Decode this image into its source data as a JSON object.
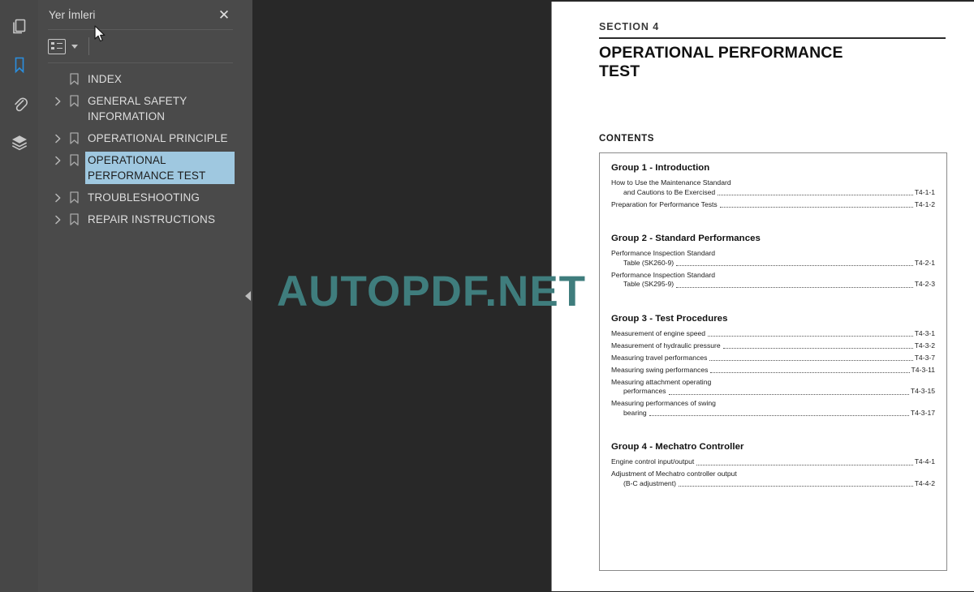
{
  "rail": {
    "items": [
      {
        "name": "pages-icon",
        "tooltip": "Pages"
      },
      {
        "name": "bookmark-icon",
        "tooltip": "Bookmarks",
        "active": true
      },
      {
        "name": "attachments-icon",
        "tooltip": "Attachments"
      },
      {
        "name": "layers-icon",
        "tooltip": "Layers"
      }
    ]
  },
  "panel": {
    "title": "Yer İmleri",
    "close_label": "✕",
    "toolbar": {
      "options_label": ""
    }
  },
  "bookmarks": [
    {
      "label": "INDEX",
      "expandable": false,
      "selected": false
    },
    {
      "label": "GENERAL SAFETY INFORMATION",
      "expandable": true,
      "selected": false
    },
    {
      "label": "OPERATIONAL PRINCIPLE",
      "expandable": true,
      "selected": false
    },
    {
      "label": "OPERATIONAL PERFORMANCE TEST",
      "expandable": true,
      "selected": true
    },
    {
      "label": "TROUBLESHOOTING",
      "expandable": true,
      "selected": false
    },
    {
      "label": "REPAIR INSTRUCTIONS",
      "expandable": true,
      "selected": false
    }
  ],
  "viewer": {
    "watermark": "AUTOPDF.NET",
    "watermark_color": "#3f7d7d",
    "background_color": "#282828"
  },
  "document": {
    "section_label": "SECTION 4",
    "title": "OPERATIONAL PERFORMANCE TEST",
    "contents_label": "CONTENTS",
    "groups": [
      {
        "title": "Group 1 - Introduction",
        "entries": [
          {
            "lines": [
              "How to Use the Maintenance Standard",
              "and Cautions to Be Exercised"
            ],
            "page": "T4-1-1"
          },
          {
            "lines": [
              "Preparation for Performance Tests"
            ],
            "page": "T4-1-2"
          }
        ]
      },
      {
        "title": "Group 2 - Standard Performances",
        "entries": [
          {
            "lines": [
              "Performance Inspection Standard",
              "Table (SK260-9)"
            ],
            "page": "T4-2-1"
          },
          {
            "lines": [
              "Performance Inspection Standard",
              "Table (SK295-9)"
            ],
            "page": "T4-2-3"
          }
        ]
      },
      {
        "title": "Group 3 - Test Procedures",
        "entries": [
          {
            "lines": [
              "Measurement of engine speed"
            ],
            "page": "T4-3-1"
          },
          {
            "lines": [
              "Measurement of hydraulic pressure"
            ],
            "page": "T4-3-2"
          },
          {
            "lines": [
              "Measuring travel performances"
            ],
            "page": "T4-3-7"
          },
          {
            "lines": [
              "Measuring swing performances"
            ],
            "page": "T4-3-11"
          },
          {
            "lines": [
              "Measuring attachment operating",
              "performances"
            ],
            "page": "T4-3-15"
          },
          {
            "lines": [
              "Measuring performances of swing",
              "bearing"
            ],
            "page": "T4-3-17"
          }
        ]
      },
      {
        "title": "Group 4 - Mechatro Controller",
        "entries": [
          {
            "lines": [
              "Engine control input/output"
            ],
            "page": "T4-4-1"
          },
          {
            "lines": [
              "Adjustment of Mechatro controller output",
              "(B-C adjustment)"
            ],
            "page": "T4-4-2"
          }
        ]
      }
    ]
  }
}
